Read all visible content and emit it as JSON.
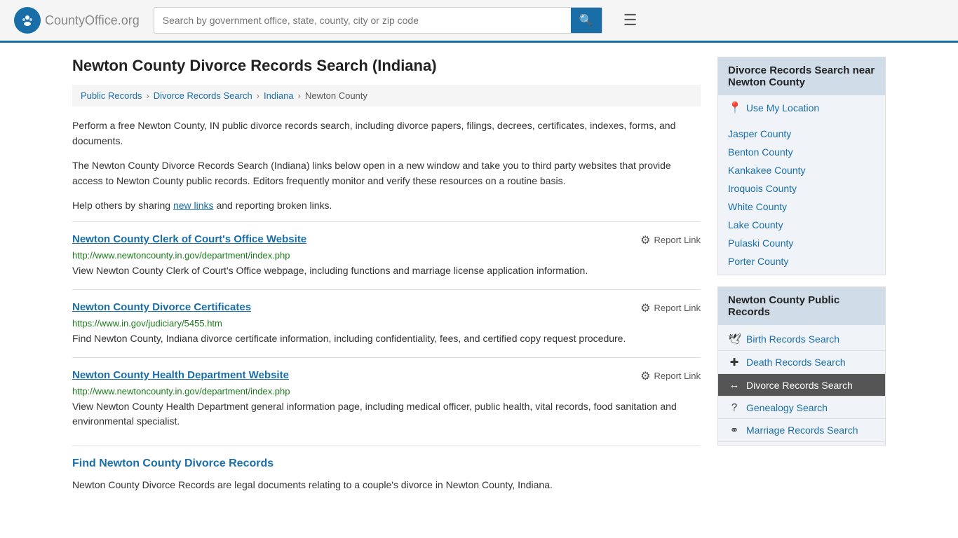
{
  "header": {
    "logo_text": "CountyOffice",
    "logo_suffix": ".org",
    "search_placeholder": "Search by government office, state, county, city or zip code",
    "search_value": ""
  },
  "page": {
    "title": "Newton County Divorce Records Search (Indiana)",
    "breadcrumb": [
      {
        "label": "Public Records",
        "href": "#"
      },
      {
        "label": "Divorce Records Search",
        "href": "#"
      },
      {
        "label": "Indiana",
        "href": "#"
      },
      {
        "label": "Newton County",
        "href": "#"
      }
    ],
    "description1": "Perform a free Newton County, IN public divorce records search, including divorce papers, filings, decrees, certificates, indexes, forms, and documents.",
    "description2": "The Newton County Divorce Records Search (Indiana) links below open in a new window and take you to third party websites that provide access to Newton County public records. Editors frequently monitor and verify these resources on a routine basis.",
    "description3_pre": "Help others by sharing ",
    "description3_link": "new links",
    "description3_post": " and reporting broken links."
  },
  "results": [
    {
      "title": "Newton County Clerk of Court's Office Website",
      "url": "http://www.newtoncounty.in.gov/department/index.php",
      "desc": "View Newton County Clerk of Court's Office webpage, including functions and marriage license application information.",
      "report_label": "Report Link"
    },
    {
      "title": "Newton County Divorce Certificates",
      "url": "https://www.in.gov/judiciary/5455.htm",
      "desc": "Find Newton County, Indiana divorce certificate information, including confidentiality, fees, and certified copy request procedure.",
      "report_label": "Report Link"
    },
    {
      "title": "Newton County Health Department Website",
      "url": "http://www.newtoncounty.in.gov/department/index.php",
      "desc": "View Newton County Health Department general information page, including medical officer, public health, vital records, food sanitation and environmental specialist.",
      "report_label": "Report Link"
    }
  ],
  "find_section": {
    "title": "Find Newton County Divorce Records",
    "para": "Newton County Divorce Records are legal documents relating to a couple's divorce in Newton County, Indiana."
  },
  "sidebar": {
    "nearby_section_title": "Divorce Records Search near Newton County",
    "use_location_label": "Use My Location",
    "nearby_counties": [
      "Jasper County",
      "Benton County",
      "Kankakee County",
      "Iroquois County",
      "White County",
      "Lake County",
      "Pulaski County",
      "Porter County"
    ],
    "public_records_title": "Newton County Public Records",
    "public_records_links": [
      {
        "label": "Birth Records Search",
        "icon": "🕊",
        "active": false
      },
      {
        "label": "Death Records Search",
        "icon": "+",
        "active": false
      },
      {
        "label": "Divorce Records Search",
        "icon": "↔",
        "active": true
      },
      {
        "label": "Genealogy Search",
        "icon": "?",
        "active": false
      },
      {
        "label": "Marriage Records Search",
        "icon": "⚭",
        "active": false
      }
    ]
  }
}
